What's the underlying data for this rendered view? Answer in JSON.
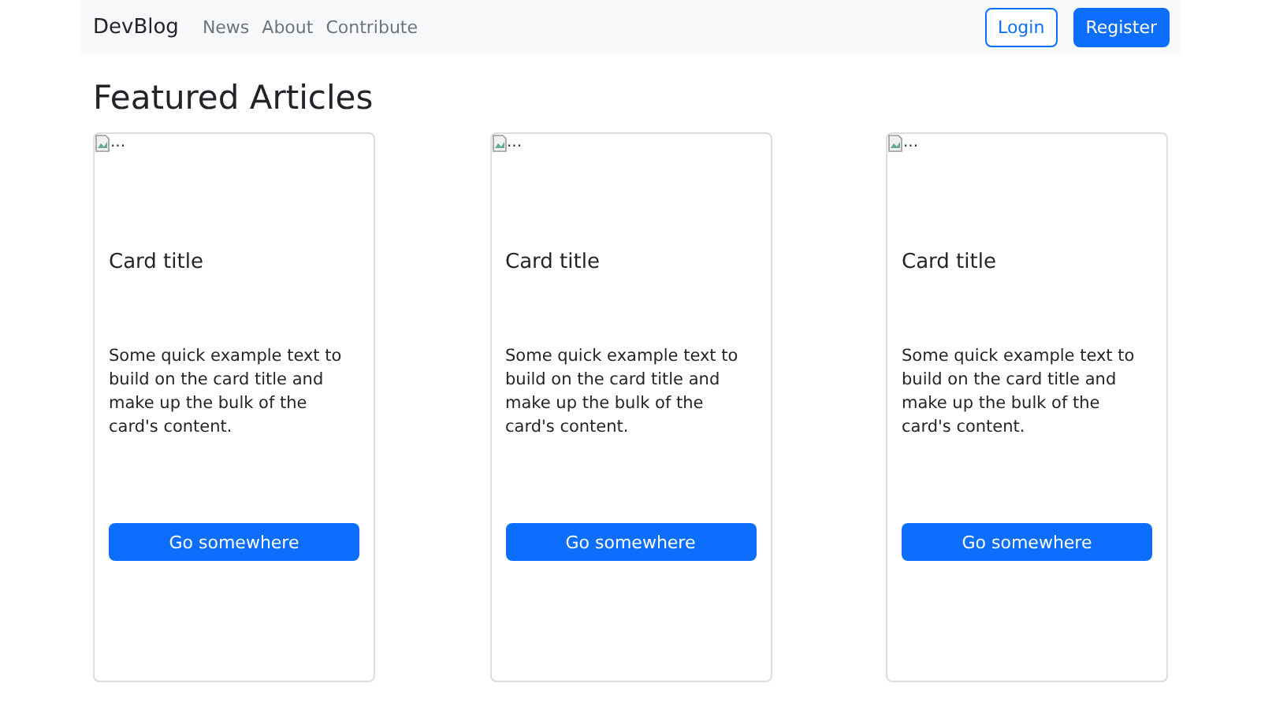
{
  "navbar": {
    "brand": "DevBlog",
    "links": [
      "News",
      "About",
      "Contribute"
    ],
    "login": "Login",
    "register": "Register"
  },
  "heading": "Featured Articles",
  "cards": [
    {
      "image_alt": "...",
      "title": "Card title",
      "text": "Some quick example text to build on the card title and make up the bulk of the card's content.",
      "button": "Go somewhere"
    },
    {
      "image_alt": "...",
      "title": "Card title",
      "text": "Some quick example text to build on the card title and make up the bulk of the card's content.",
      "button": "Go somewhere"
    },
    {
      "image_alt": "...",
      "title": "Card title",
      "text": "Some quick example text to build on the card title and make up the bulk of the card's content.",
      "button": "Go somewhere"
    }
  ]
}
